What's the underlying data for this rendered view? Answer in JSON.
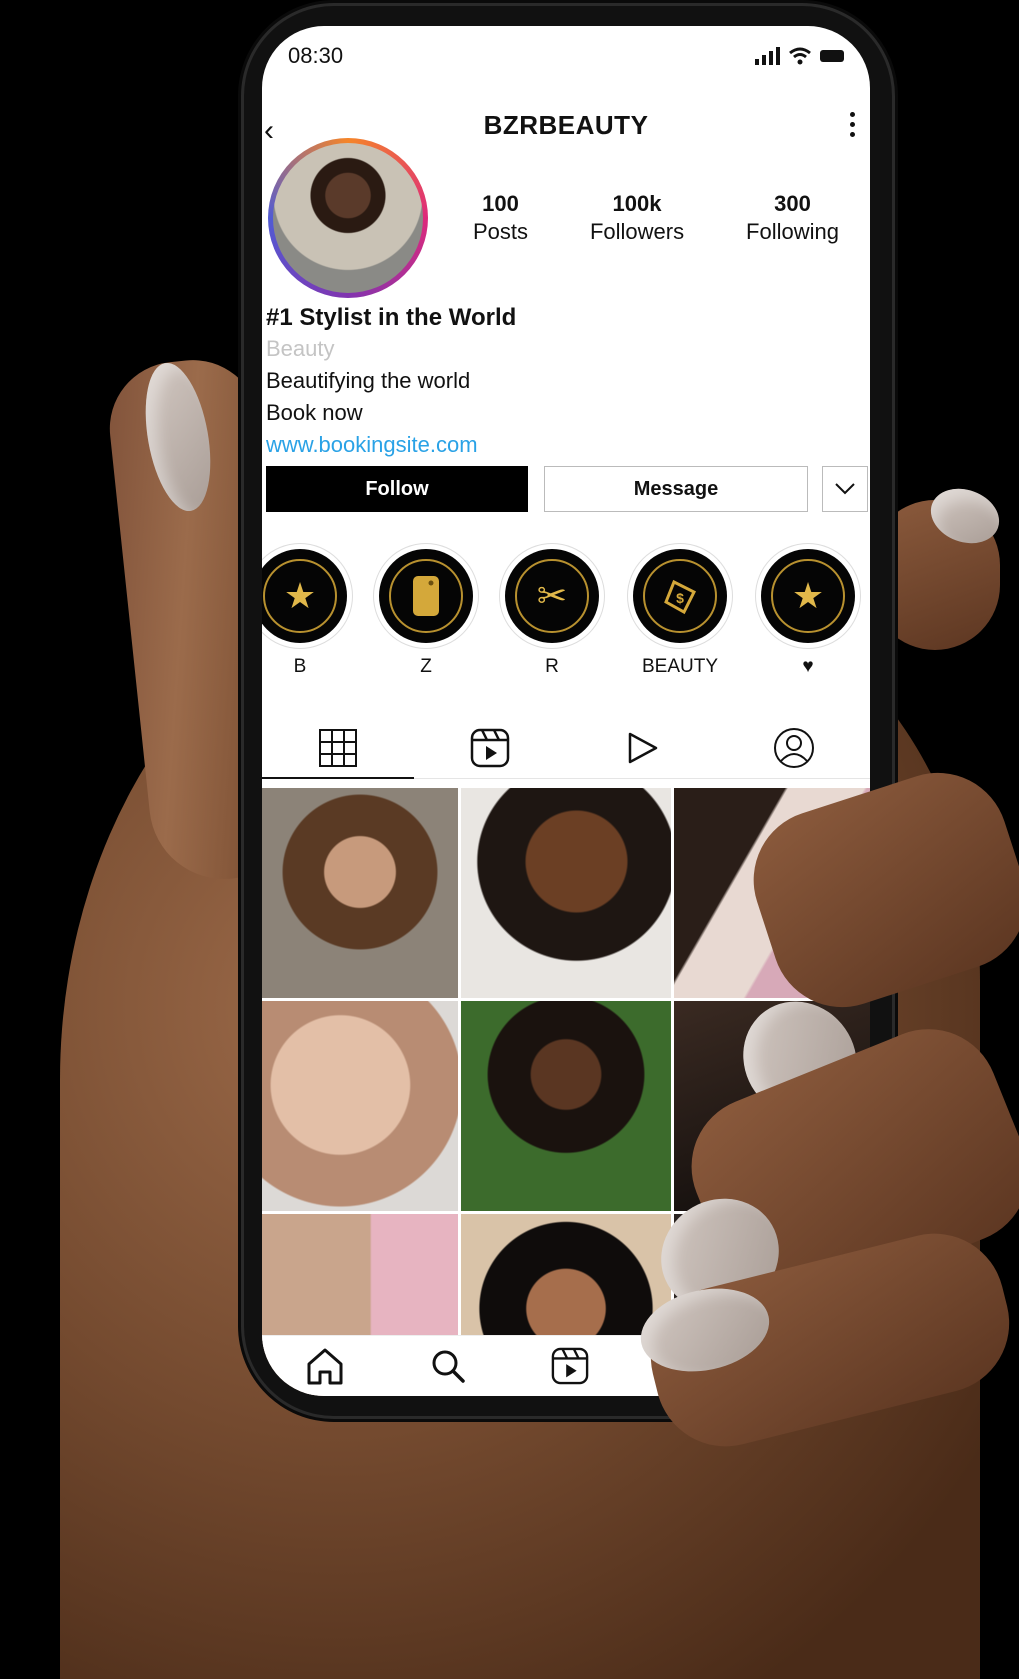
{
  "status_bar": {
    "time": "08:30"
  },
  "header": {
    "username": "BZRBEAUTY"
  },
  "profile": {
    "stats": [
      {
        "value": "100",
        "label": "Posts"
      },
      {
        "value": "100k",
        "label": "Followers"
      },
      {
        "value": "300",
        "label": "Following"
      }
    ],
    "display_name": "#1 Stylist in the World",
    "category": "Beauty",
    "bio_lines": [
      "Beautifying the world",
      "Book now"
    ],
    "link": "www.bookingsite.com"
  },
  "actions": {
    "follow_label": "Follow",
    "message_label": "Message"
  },
  "highlights": [
    {
      "label": "B",
      "icon": "star-icon"
    },
    {
      "label": "Z",
      "icon": "phone-icon"
    },
    {
      "label": "R",
      "icon": "scissors-icon"
    },
    {
      "label": "BEAUTY",
      "icon": "price-tag-icon"
    },
    {
      "label": "♥",
      "icon": "star-icon"
    }
  ],
  "tabs": [
    {
      "name": "grid-icon"
    },
    {
      "name": "reels-icon"
    },
    {
      "name": "play-icon"
    },
    {
      "name": "tagged-icon"
    }
  ],
  "colors": {
    "link": "#2aa2e6",
    "highlight_gold": "#e1b84a",
    "follow_button": "#000000"
  }
}
